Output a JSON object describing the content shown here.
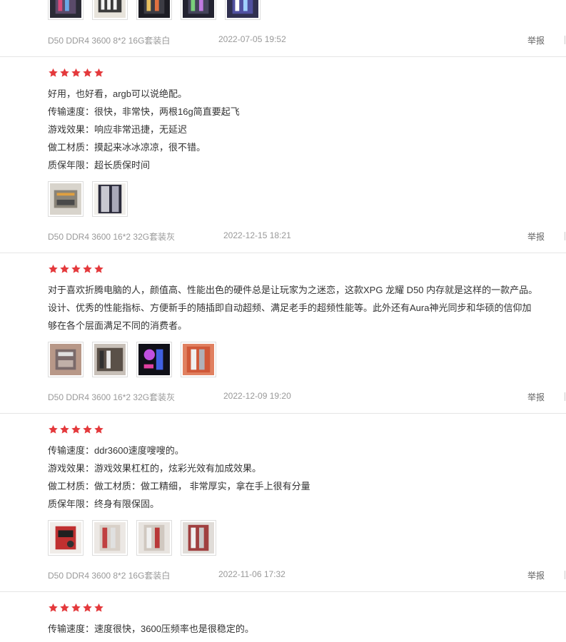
{
  "colors": {
    "star": "#e4393c",
    "divider": "#e5e5e5",
    "meta_text": "#999999",
    "report_text": "#666666",
    "body_text": "#333333"
  },
  "icons": {
    "star": "star-icon",
    "thumbnail": "photo-thumbnail"
  },
  "reviews": [
    {
      "rating": 5,
      "lines": [],
      "thumb_count": 5,
      "variant": "D50 DDR4 3600 8*2 16G套装白",
      "date": "2022-07-05 19:52",
      "report": "举报"
    },
    {
      "rating": 5,
      "lines": [
        "好用，也好看，argb可以说绝配。",
        "传输速度：很快，非常快，两根16g简直要起飞",
        "游戏效果：响应非常迅捷，无延迟",
        "做工材质：摸起来冰冰凉凉，很不错。",
        "质保年限：超长质保时间"
      ],
      "thumb_count": 2,
      "variant": "D50 DDR4 3600 16*2 32G套装灰",
      "date": "2022-12-15 18:21",
      "report": "举报"
    },
    {
      "rating": 5,
      "lines": [
        "对于喜欢折腾电脑的人，颜值高、性能出色的硬件总是让玩家为之迷恋，这款XPG 龙耀 D50 内存就是这样的一款产品。",
        "设计、优秀的性能指标、方便新手的随插即自动超频、满足老手的超频性能等。此外还有Aura神光同步和华硕的信仰加",
        "够在各个层面满足不同的消费者。"
      ],
      "thumb_count": 4,
      "variant": "D50 DDR4 3600 16*2 32G套装灰",
      "date": "2022-12-09 19:20",
      "report": "举报"
    },
    {
      "rating": 5,
      "lines": [
        "传输速度：ddr3600速度嗖嗖的。",
        "游戏效果：游戏效果杠杠的，炫彩光效有加成效果。",
        "做工材质：做工材质：做工精细， 非常厚实，拿在手上很有分量",
        "质保年限：终身有限保固。"
      ],
      "thumb_count": 4,
      "variant": "D50 DDR4 3600 8*2 16G套装白",
      "date": "2022-11-06 17:32",
      "report": "举报"
    },
    {
      "rating": 5,
      "lines": [
        "传输速度：速度很快，3600压频率也是很稳定的。"
      ],
      "thumb_count": 0,
      "variant": "",
      "date": "",
      "report": ""
    }
  ]
}
